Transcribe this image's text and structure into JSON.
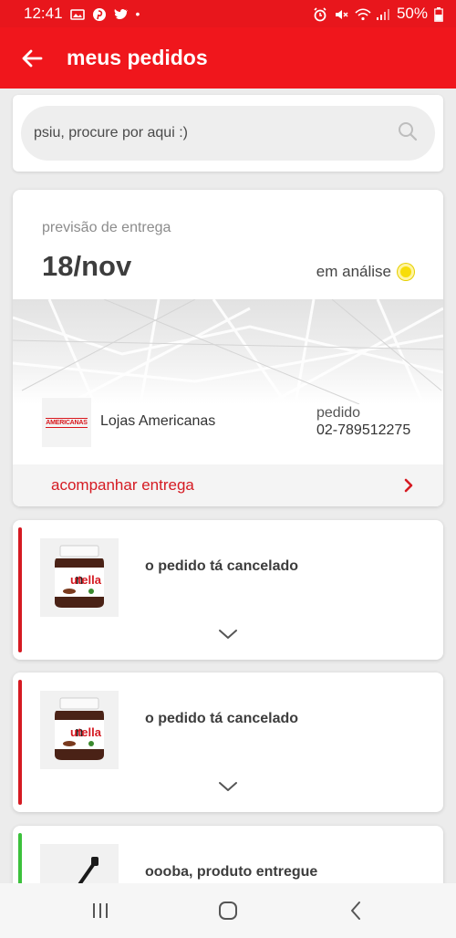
{
  "status_bar": {
    "time": "12:41",
    "battery": "50%",
    "left_icons": [
      "photo-icon",
      "pinterest-icon",
      "twitter-icon",
      "dot-icon"
    ],
    "right_icons": [
      "alarm-icon",
      "mute-icon",
      "wifi-icon",
      "signal-icon",
      "battery-icon"
    ]
  },
  "app_bar": {
    "title": "meus pedidos",
    "back_icon": "back-arrow-icon"
  },
  "search": {
    "placeholder": "psiu, procure por aqui :)",
    "icon": "search-icon"
  },
  "order": {
    "forecast_label": "previsão de entrega",
    "forecast_date": "18/nov",
    "status": "em análise",
    "status_color": "#f7dd08",
    "store_logo_text": "AMERICANAS",
    "store_name": "Lojas Americanas",
    "order_label": "pedido",
    "order_number": "02-789512275",
    "track_label": "acompanhar entrega"
  },
  "items": [
    {
      "status_text": "o pedido tá cancelado",
      "accent_color": "#d51a22",
      "image": "nutella-jar"
    },
    {
      "status_text": "o pedido tá cancelado",
      "accent_color": "#d51a22",
      "image": "nutella-jar"
    },
    {
      "status_text": "oooba, produto entregue",
      "accent_color": "#3cc13c",
      "image": "handheld-vacuum"
    }
  ],
  "nav_bar": {
    "buttons": [
      "recent-apps-icon",
      "home-icon",
      "back-icon"
    ]
  },
  "colors": {
    "brand_red": "#f0161c",
    "accent_red": "#d51a22",
    "delivered_green": "#3cc13c"
  }
}
